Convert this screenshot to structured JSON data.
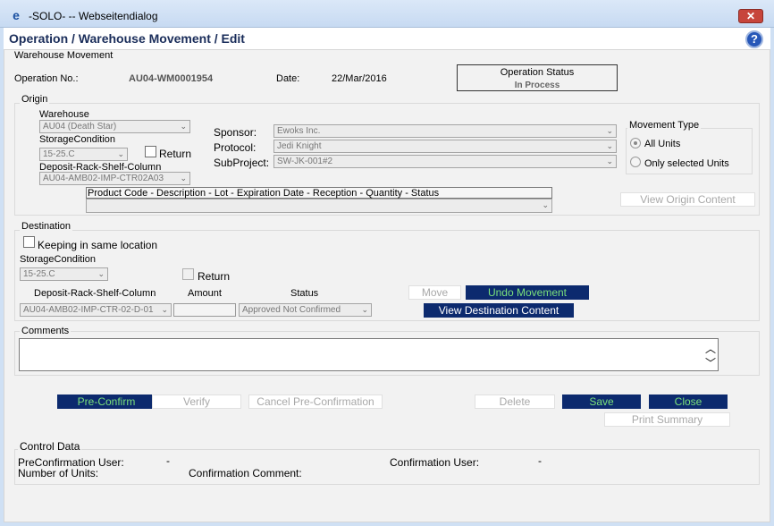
{
  "window": {
    "title": "-SOLO- -- Webseitendialog",
    "icon": "ie-icon"
  },
  "header": {
    "title": "Operation / Warehouse Movement / Edit"
  },
  "section_title": "Warehouse Movement",
  "op": {
    "no_label": "Operation No.:",
    "no_value": "AU04-WM0001954",
    "date_label": "Date:",
    "date_value": "22/Mar/2016",
    "status_label": "Operation Status",
    "status_value": "In Process"
  },
  "origin": {
    "legend": "Origin",
    "warehouse_label": "Warehouse",
    "warehouse_value": "AU04 (Death Star)",
    "storage_label": "StorageCondition",
    "storage_value": "15-25.C",
    "return_label": "Return",
    "drsc_label": "Deposit-Rack-Shelf-Column",
    "drsc_value": "AU04-AMB02-IMP-CTR02A03",
    "sponsor_label": "Sponsor:",
    "sponsor_value": "Ewoks Inc.",
    "protocol_label": "Protocol:",
    "protocol_value": "Jedi Knight",
    "subproject_label": "SubProject:",
    "subproject_value": "SW-JK-001#2",
    "movement_legend": "Movement Type",
    "all_units": "All Units",
    "only_selected": "Only selected Units",
    "product_header": "Product Code - Description - Lot - Expiration Date - Reception - Quantity - Status",
    "view_origin": "View Origin Content"
  },
  "destination": {
    "legend": "Destination",
    "keeping_label": "Keeping in same location",
    "storage_label": "StorageCondition",
    "storage_value": "15-25.C",
    "return_label": "Return",
    "drsc_label": "Deposit-Rack-Shelf-Column",
    "amount_label": "Amount",
    "status_label": "Status",
    "drsc_value": "AU04-AMB02-IMP-CTR-02-D-01",
    "status_value": "Approved Not Confirmed",
    "move": "Move",
    "undo": "Undo Movement",
    "view_dest": "View Destination Content"
  },
  "comments": {
    "label": "Comments"
  },
  "actions": {
    "preconfirm": "Pre-Confirm",
    "verify": "Verify",
    "cancel_pre": "Cancel Pre-Confirmation",
    "delete": "Delete",
    "save": "Save",
    "close": "Close",
    "print": "Print Summary"
  },
  "control": {
    "legend": "Control Data",
    "preconf_user_label": "PreConfirmation User:",
    "preconf_user_value": "-",
    "conf_user_label": "Confirmation User:",
    "conf_user_value": "-",
    "units_label": "Number of Units:",
    "conf_comment_label": "Confirmation Comment:"
  }
}
